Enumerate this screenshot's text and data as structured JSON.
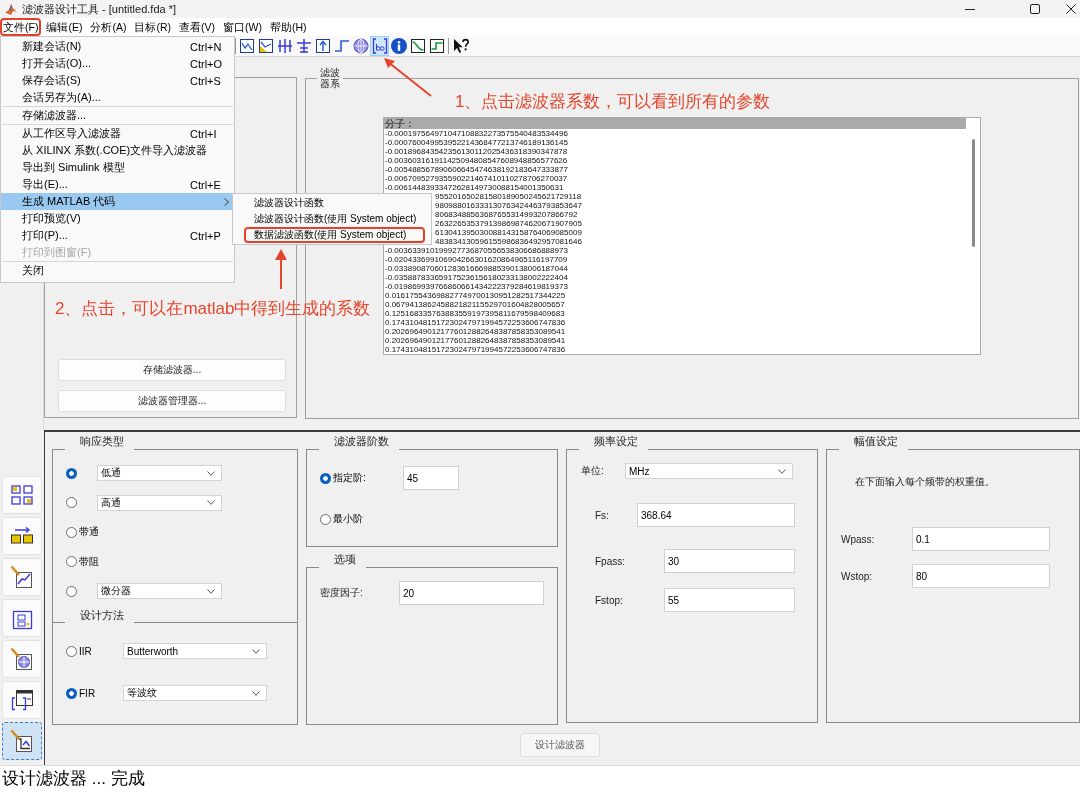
{
  "window": {
    "title": "滤波器设计工具 - [untitled.fda *]"
  },
  "menu_bar": [
    {
      "label": "文件(F)",
      "circled": true
    },
    {
      "label": "编辑(E)",
      "circled": false
    },
    {
      "label": "分析(A)",
      "circled": false
    },
    {
      "label": "目标(R)",
      "circled": false
    },
    {
      "label": "查看(V)",
      "circled": false
    },
    {
      "label": "窗口(W)",
      "circled": false
    },
    {
      "label": "帮助(H)",
      "circled": false
    }
  ],
  "toolbar": [
    {
      "selected": false
    },
    {
      "selected": false
    },
    {
      "selected": false
    },
    {
      "selected": false
    },
    {
      "selected": false
    },
    {
      "selected": false
    },
    {
      "selected": false
    },
    {
      "selected": true
    },
    {
      "selected": false
    },
    {
      "selected": false
    },
    {
      "selected": false
    },
    {
      "selected": false
    }
  ],
  "file_menu": {
    "groups": [
      {
        "items": [
          {
            "label": "新建会话(N)",
            "shortcut": "Ctrl+N",
            "kind": "command",
            "selected": false,
            "disabled": false
          },
          {
            "label": "打开会话(O)...",
            "shortcut": "Ctrl+O",
            "kind": "command",
            "selected": false,
            "disabled": false
          },
          {
            "label": "保存会话(S)",
            "shortcut": "Ctrl+S",
            "kind": "command",
            "selected": false,
            "disabled": false
          },
          {
            "label": "会话另存为(A)...",
            "kind": "command",
            "selected": false,
            "disabled": false
          }
        ]
      },
      {
        "items": [
          {
            "label": "存储滤波器...",
            "kind": "command",
            "selected": false,
            "disabled": false
          }
        ]
      },
      {
        "items": [
          {
            "label": "从工作区导入滤波器",
            "shortcut": "Ctrl+I",
            "kind": "command",
            "selected": false,
            "disabled": false
          },
          {
            "label": "从 XILINX 系数(.COE)文件导入滤波器",
            "kind": "command",
            "selected": false,
            "disabled": false
          },
          {
            "label": "导出到 Simulink 模型",
            "kind": "command",
            "selected": false,
            "disabled": false
          },
          {
            "label": "导出(E)...",
            "shortcut": "Ctrl+E",
            "kind": "command",
            "selected": false,
            "disabled": false
          },
          {
            "label": "生成 MATLAB 代码",
            "kind": "submenu",
            "selected": true,
            "disabled": false
          },
          {
            "label": "打印预览(V)",
            "kind": "command",
            "selected": false,
            "disabled": false
          },
          {
            "label": "打印(P)...",
            "shortcut": "Ctrl+P",
            "kind": "command",
            "selected": false,
            "disabled": false
          },
          {
            "label": "打印到图窗(F)",
            "kind": "command",
            "selected": false,
            "disabled": true
          }
        ]
      },
      {
        "items": [
          {
            "label": "关闭",
            "kind": "command",
            "selected": false,
            "disabled": false
          }
        ]
      }
    ]
  },
  "submenu": {
    "items": [
      {
        "label": "滤波器设计函数",
        "selected": false,
        "circled": false
      },
      {
        "label": "滤波器设计函数(使用 System object)",
        "selected": false,
        "circled": false
      },
      {
        "label": "数据滤波函数(使用 System object)",
        "selected": false,
        "circled": true
      }
    ]
  },
  "left_panel": {
    "buttons": [
      "存储滤波器...",
      "滤波器管理器..."
    ]
  },
  "coefficients": {
    "title": "滤波器系",
    "list": {
      "items": [
        {
          "text": "分子：",
          "selected": true,
          "covered": false
        },
        {
          "text": "-0.000197564971047108832273575540483534496",
          "selected": false,
          "covered": false
        },
        {
          "text": "-0.000760049953952214368477213746189136145",
          "selected": false,
          "covered": false
        },
        {
          "text": "-0.001896843542356130112025436318390347878",
          "selected": false,
          "covered": false
        },
        {
          "text": "-0.003603161911425094808547608948856577626",
          "selected": false,
          "covered": false
        },
        {
          "text": "-0.005488567890606645474638192183647333877",
          "selected": false,
          "covered": false
        },
        {
          "text": "-0.006709527935590221467410110278706270037",
          "selected": false,
          "covered": false
        },
        {
          "text": "-0.00614483933472628149730088154001350631",
          "selected": false,
          "covered": false
        },
        {
          "text": "955201650281580189050245621729118",
          "selected": false,
          "covered": true
        },
        {
          "text": "980988016333130763424463793853647",
          "selected": false,
          "covered": true
        },
        {
          "text": "80683488563687655314993207866792",
          "selected": false,
          "covered": true
        },
        {
          "text": "263226535379139869874620671907905",
          "selected": false,
          "covered": true
        },
        {
          "text": "613041395030088143158764069085009",
          "selected": false,
          "covered": true
        },
        {
          "text": "483834130596155986836492957081646",
          "selected": false,
          "covered": true
        },
        {
          "text": "-0.003633910199927736870556538306686888973",
          "selected": false,
          "covered": false
        },
        {
          "text": "-0.020433699106904266301620864965116197709",
          "selected": false,
          "covered": false
        },
        {
          "text": "-0.033890870601283616669885390138006187044",
          "selected": false,
          "covered": false
        },
        {
          "text": "-0.035887833659175236156180233138002222404",
          "selected": false,
          "covered": false
        },
        {
          "text": "-0.019869939766860661434222379284619819373",
          "selected": false,
          "covered": false
        },
        {
          "text": "0.016175543698827749700130951282517344225",
          "selected": false,
          "covered": false
        },
        {
          "text": "0.067941386245882182115529701604828005657",
          "selected": false,
          "covered": false
        },
        {
          "text": "0.125168335763883559197395811679598409683",
          "selected": false,
          "covered": false
        },
        {
          "text": "0.174310481517230247971994572253606747836",
          "selected": false,
          "covered": false
        },
        {
          "text": "0.202696490121776012882648387858353089541",
          "selected": false,
          "covered": false
        },
        {
          "text": "0.202696490121776012882648387858353089541",
          "selected": false,
          "covered": false
        },
        {
          "text": "0.174310481517230247971994572253606747836",
          "selected": false,
          "covered": false
        }
      ]
    }
  },
  "response_type": {
    "title": "响应类型",
    "options": [
      {
        "kind": "dropdown",
        "value": "低通",
        "selected": true
      },
      {
        "kind": "dropdown",
        "value": "高通",
        "selected": false
      },
      {
        "kind": "label",
        "label": "带通",
        "selected": false
      },
      {
        "kind": "label",
        "label": "带阻",
        "selected": false
      },
      {
        "kind": "dropdown",
        "value": "微分器",
        "selected": false
      }
    ]
  },
  "design_method": {
    "title": "设计方法",
    "options": [
      {
        "label": "IIR",
        "value": "Butterworth",
        "selected": false
      },
      {
        "label": "FIR",
        "value": "等波纹",
        "selected": true
      }
    ]
  },
  "filter_order": {
    "title": "滤波器阶数",
    "options": [
      {
        "kind": "input",
        "label": "指定阶:",
        "value": "45",
        "selected": true
      },
      {
        "kind": "label",
        "label": "最小阶",
        "selected": false
      }
    ]
  },
  "options": {
    "title": "选项",
    "fields": [
      {
        "label": "密度因子:",
        "value": "20"
      }
    ]
  },
  "frequency": {
    "title": "频率设定",
    "unit": {
      "label": "单位:",
      "value": "MHz"
    },
    "fields": [
      {
        "label": "Fs:",
        "value": "368.64"
      },
      {
        "label": "Fpass:",
        "value": "30"
      },
      {
        "label": "Fstop:",
        "value": "55"
      }
    ]
  },
  "magnitude": {
    "title": "幅值设定",
    "note": "在下面输入每个频带的权重值。",
    "fields": [
      {
        "label": "Wpass:",
        "value": "0.1"
      },
      {
        "label": "Wstop:",
        "value": "80"
      }
    ]
  },
  "design_button": {
    "label": "设计滤波器"
  },
  "side_toolbar": [
    {
      "selected": false
    },
    {
      "selected": false
    },
    {
      "selected": false
    },
    {
      "selected": false
    },
    {
      "selected": false
    },
    {
      "selected": false
    },
    {
      "selected": true
    }
  ],
  "status_bar": {
    "text": "设计滤波器 ... 完成"
  },
  "annotations": [
    {
      "text": "1、点击滤波器系数，可以看到所有的参数"
    },
    {
      "text": "2、点击，可以在matlab中得到生成的系数"
    }
  ]
}
